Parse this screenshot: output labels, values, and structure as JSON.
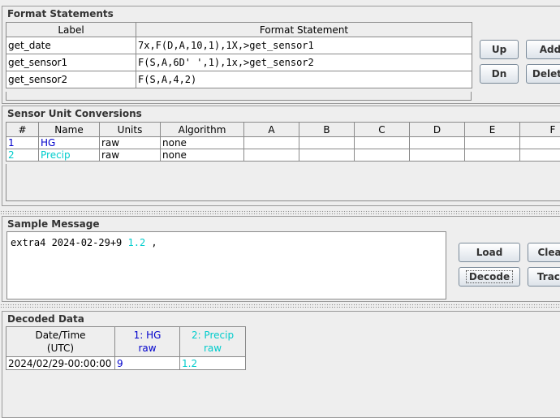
{
  "format_statements": {
    "title": "Format Statements",
    "columns": [
      "Label",
      "Format Statement"
    ],
    "rows": [
      {
        "label": "get_date",
        "statement": "7x,F(D,A,10,1),1X,>get_sensor1"
      },
      {
        "label": "get_sensor1",
        "statement": "F(S,A,6D' ',1),1x,>get_sensor2"
      },
      {
        "label": "get_sensor2",
        "statement": "F(S,A,4,2)"
      }
    ],
    "buttons": {
      "up": "Up",
      "add": "Add",
      "dn": "Dn",
      "delete": "Delete"
    }
  },
  "sensor_conversions": {
    "title": "Sensor Unit Conversions",
    "columns": [
      "#",
      "Name",
      "Units",
      "Algorithm",
      "A",
      "B",
      "C",
      "D",
      "E",
      "F"
    ],
    "rows": [
      {
        "num": "1",
        "name": "HG",
        "units": "raw",
        "algorithm": "none",
        "color": "#0000cc"
      },
      {
        "num": "2",
        "name": "Precip",
        "units": "raw",
        "algorithm": "none",
        "color": "#00cccc"
      }
    ]
  },
  "sample_message": {
    "title": "Sample Message",
    "text_plain": "extra4 2024-02-29+9 ",
    "text_blue": "1.2",
    "text_tail": " ,",
    "buttons": {
      "load": "Load",
      "clear": "Clear",
      "decode": "Decode",
      "trace": "Trace"
    }
  },
  "decoded_data": {
    "title": "Decoded Data",
    "columns": [
      {
        "line1": "Date/Time",
        "line2": "(UTC)",
        "color": "#000000"
      },
      {
        "line1": "1: HG",
        "line2": "raw",
        "color": "#0000cc"
      },
      {
        "line1": "2: Precip",
        "line2": "raw",
        "color": "#00cccc"
      }
    ],
    "rows": [
      {
        "datetime": "2024/02/29-00:00:00",
        "hg": "9",
        "precip": "1.2"
      }
    ]
  }
}
